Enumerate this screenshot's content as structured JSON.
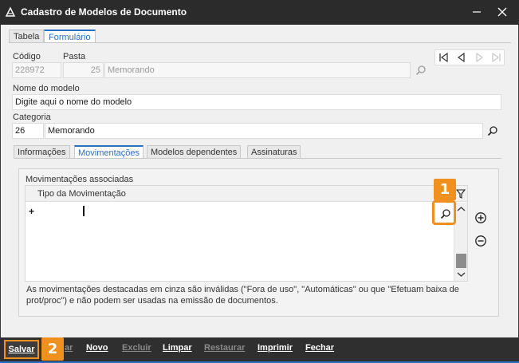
{
  "window": {
    "title": "Cadastro de Modelos de Documento"
  },
  "tabs": [
    "Tabela",
    "Formulário"
  ],
  "form": {
    "codigo_label": "Código",
    "codigo_value": "228972",
    "pasta_label": "Pasta",
    "pasta_num": "25",
    "pasta_name": "Memorando",
    "nome_label": "Nome do modelo",
    "nome_value": "Digite aqui o nome do modelo",
    "categoria_label": "Categoria",
    "categoria_num": "26",
    "categoria_name": "Memorando"
  },
  "subtabs": [
    "Informações",
    "Movimentações",
    "Modelos dependentes",
    "Assinaturas"
  ],
  "movimentacoes": {
    "section_label": "Movimentações associadas",
    "column_header": "Tipo da Movimentação",
    "new_row_marker": "+",
    "note": "As movimentações destacadas em cinza são inválidas (\"Fora de uso\", \"Automáticas\" ou que \"Efetuam baixa de prot/proc\") e não podem ser usadas na emissão de documentos."
  },
  "callouts": [
    "1",
    "2"
  ],
  "footer": {
    "salvar": "Salvar",
    "hidden_partial": "ar",
    "novo": "Novo",
    "excluir": "Excluir",
    "limpar": "Limpar",
    "restaurar": "Restaurar",
    "imprimir": "Imprimir",
    "fechar": "Fechar"
  },
  "colors": {
    "accent": "#2a6fc2",
    "highlight": "#f0901e",
    "titlebar": "#2b2b2b"
  }
}
